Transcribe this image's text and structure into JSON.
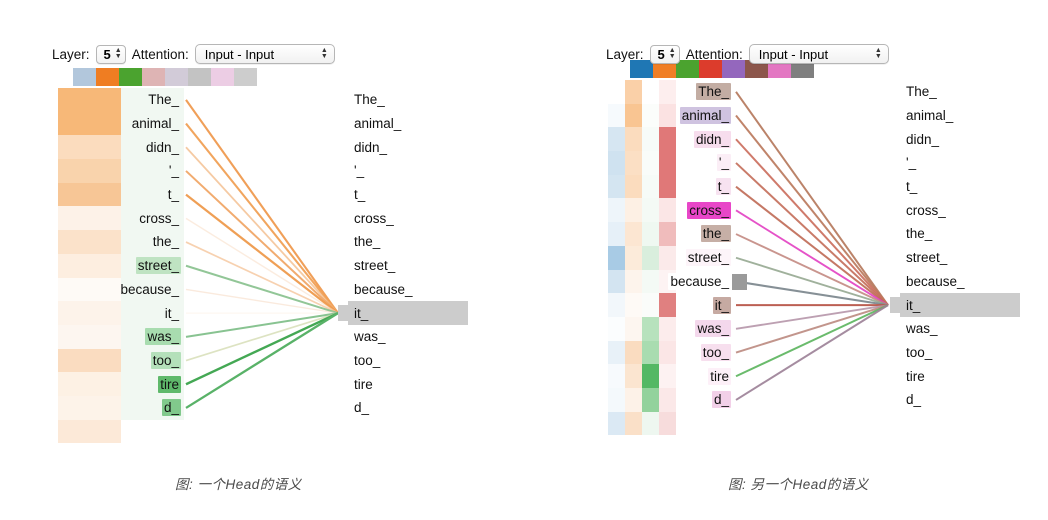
{
  "page": {
    "background": "#ffffff",
    "highlight_gray": "#cccccc",
    "selected_token": "it_"
  },
  "panels": [
    {
      "id": "left",
      "caption": "图: 一个Head的语义",
      "controls": {
        "layer_label": "Layer:",
        "layer_value": "5",
        "attention_label": "Attention:",
        "attention_value": "Input - Input",
        "up_arrow_icon": "▲",
        "down_arrow_icon": "▼"
      },
      "head_swatches": [
        {
          "name": "head-0",
          "color": "#b2c7dc"
        },
        {
          "name": "head-1",
          "color": "#ef7d22"
        },
        {
          "name": "head-2",
          "color": "#4ba32f"
        },
        {
          "name": "head-3",
          "color": "#deb4b4"
        },
        {
          "name": "head-4",
          "color": "#d2cbd8"
        },
        {
          "name": "head-5",
          "color": "#c3c3c3"
        },
        {
          "name": "head-6",
          "color": "#eccde4"
        },
        {
          "name": "head-7",
          "color": "#cdcdcd"
        }
      ],
      "tokens": [
        "The_",
        "animal_",
        "didn_",
        "'_",
        "t_",
        "cross_",
        "the_",
        "street_",
        "because_",
        "it_",
        "was_",
        "too_",
        "tire",
        "d_"
      ],
      "selected_index": 9,
      "heat_columns": [
        {
          "name": "orange-attention-column",
          "values": [
            "#f7b878",
            "#f7b878",
            "#fbdcbe",
            "#f9d3ac",
            "#f7c696",
            "#fdf2e8",
            "#fbe2ca",
            "#fdeee0",
            "#fefaf6",
            "#fdf3ea",
            "#fdf6f0",
            "#fadcc0",
            "#fdf1e4",
            "#fdf3e9",
            "#fce9d8"
          ]
        }
      ],
      "token_highlights": [
        {
          "index": 7,
          "color": "#bfe3c2"
        },
        {
          "index": 10,
          "color": "#a8dcaf"
        },
        {
          "index": 11,
          "color": "#b4e0ba"
        },
        {
          "index": 12,
          "color": "#5fb96b"
        },
        {
          "index": 13,
          "color": "#81c98c"
        }
      ],
      "token_column_bg": "#f1f8f2",
      "edges": [
        {
          "from": 0,
          "color": "#ef9a4f",
          "width": 2.1,
          "opacity": 0.95
        },
        {
          "from": 1,
          "color": "#f0a055",
          "width": 2.1,
          "opacity": 0.95
        },
        {
          "from": 2,
          "color": "#f2b884",
          "width": 1.8,
          "opacity": 0.75
        },
        {
          "from": 3,
          "color": "#efa25f",
          "width": 2.0,
          "opacity": 0.9
        },
        {
          "from": 4,
          "color": "#ee9a4c",
          "width": 2.2,
          "opacity": 0.95
        },
        {
          "from": 5,
          "color": "#f8ddc4",
          "width": 1.4,
          "opacity": 0.55
        },
        {
          "from": 6,
          "color": "#f3bd8e",
          "width": 1.7,
          "opacity": 0.7
        },
        {
          "from": 7,
          "color": "#86c08c",
          "width": 2.0,
          "opacity": 0.9
        },
        {
          "from": 8,
          "color": "#f6d6bb",
          "width": 1.3,
          "opacity": 0.5
        },
        {
          "from": 9,
          "color": "#fbeadd",
          "width": 1.2,
          "opacity": 0.4
        },
        {
          "from": 10,
          "color": "#7bbd85",
          "width": 2.0,
          "opacity": 0.9
        },
        {
          "from": 11,
          "color": "#cfd7a8",
          "width": 1.7,
          "opacity": 0.7
        },
        {
          "from": 12,
          "color": "#44a854",
          "width": 2.4,
          "opacity": 1.0
        },
        {
          "from": 13,
          "color": "#59b268",
          "width": 2.3,
          "opacity": 1.0
        }
      ]
    },
    {
      "id": "right",
      "caption": "图: 另一个Head的语义",
      "controls": {
        "layer_label": "Layer:",
        "layer_value": "5",
        "attention_label": "Attention:",
        "attention_value": "Input - Input",
        "up_arrow_icon": "▲",
        "down_arrow_icon": "▼"
      },
      "head_swatches": [
        {
          "name": "head-0",
          "color": "#1f77b4"
        },
        {
          "name": "head-1",
          "color": "#f07e25"
        },
        {
          "name": "head-2",
          "color": "#4ba32f"
        },
        {
          "name": "head-3",
          "color": "#dc3c2c"
        },
        {
          "name": "head-4",
          "color": "#9467bd"
        },
        {
          "name": "head-5",
          "color": "#8c564b"
        },
        {
          "name": "head-6",
          "color": "#e377c2"
        },
        {
          "name": "head-7",
          "color": "#7f7f7f"
        }
      ],
      "tokens": [
        "The_",
        "animal_",
        "didn_",
        "'_",
        "t_",
        "cross_",
        "the_",
        "street_",
        "because_",
        "it_",
        "was_",
        "too_",
        "tire",
        "d_"
      ],
      "selected_index": 9,
      "heat_columns": [
        {
          "name": "blue-attention-column",
          "values": [
            "#ffffff",
            "#f6fafd",
            "#d6e6f2",
            "#cfe2f0",
            "#d4e5f1",
            "#eef5fa",
            "#e6f0f8",
            "#a8cbe5",
            "#d3e4f1",
            "#f2f7fb",
            "#fbfdfe",
            "#e8f1f8",
            "#f7fafd",
            "#f4f9fc",
            "#dbe9f4"
          ]
        },
        {
          "name": "orange-attention-column",
          "values": [
            "#fad0a8",
            "#f9c592",
            "#fbdcbe",
            "#fbdfc4",
            "#fbdcbe",
            "#fdf0e4",
            "#fce6d2",
            "#fcebda",
            "#fdf4ec",
            "#fefaf6",
            "#fdf6f0",
            "#fadcc0",
            "#fbe5d0",
            "#fdf2e8",
            "#fae0c8"
          ]
        },
        {
          "name": "green-attention-column",
          "values": [
            "#ffffff",
            "#fbfdfb",
            "#f7fbf8",
            "#f9fcf9",
            "#f6fbf7",
            "#f4faf5",
            "#eff8f1",
            "#d9eedd",
            "#f4faf5",
            "#fafcfa",
            "#b7e2bd",
            "#a9dcb0",
            "#54b864",
            "#93d29c",
            "#eef7f0"
          ]
        },
        {
          "name": "red-attention-column",
          "values": [
            "#fdeeee",
            "#fbe2e2",
            "#e07878",
            "#e07878",
            "#e07878",
            "#fbe6e6",
            "#f0bcbc",
            "#fbeaea",
            "#fdf3f3",
            "#e08080",
            "#fcecec",
            "#fbe6e6",
            "#fdf2f2",
            "#fbe8e8",
            "#f7dcdc"
          ]
        }
      ],
      "token_highlights": [
        {
          "index": 0,
          "color": "#c3ada3"
        },
        {
          "index": 1,
          "color": "#cfc3e0"
        },
        {
          "index": 2,
          "color": "#f7dded"
        },
        {
          "index": 3,
          "color": "#fbeef6"
        },
        {
          "index": 4,
          "color": "#f7e2f0"
        },
        {
          "index": 5,
          "color": "#e846c8"
        },
        {
          "index": 6,
          "color": "#c6afa6"
        },
        {
          "index": 7,
          "color": "#fdf4f9"
        },
        {
          "index": 8,
          "color": "#ffffff"
        },
        {
          "index": 9,
          "color": "#c6aaa2"
        },
        {
          "index": 10,
          "color": "#f4d8ec"
        },
        {
          "index": 11,
          "color": "#f7dfee"
        },
        {
          "index": 12,
          "color": "#fdf0f8"
        },
        {
          "index": 13,
          "color": "#f2d0e8"
        }
      ],
      "token_column_bg": "#ffffff",
      "gray_marker": {
        "name": "because-gray-marker",
        "index": 8,
        "color": "#9a9a9a"
      },
      "edges": [
        {
          "from": 0,
          "color": "#b5785c",
          "width": 2.0,
          "opacity": 0.92
        },
        {
          "from": 1,
          "color": "#bb7a5d",
          "width": 2.0,
          "opacity": 0.92
        },
        {
          "from": 2,
          "color": "#cb6f5e",
          "width": 2.0,
          "opacity": 0.92
        },
        {
          "from": 3,
          "color": "#c4705c",
          "width": 2.0,
          "opacity": 0.92
        },
        {
          "from": 4,
          "color": "#c06d58",
          "width": 2.0,
          "opacity": 0.92
        },
        {
          "from": 5,
          "color": "#e23fc2",
          "width": 1.9,
          "opacity": 0.9
        },
        {
          "from": 6,
          "color": "#c0827a",
          "width": 1.9,
          "opacity": 0.85
        },
        {
          "from": 7,
          "color": "#8fa38b",
          "width": 1.9,
          "opacity": 0.85
        },
        {
          "from": 8,
          "color": "#7f8a90",
          "width": 2.1,
          "opacity": 0.95
        },
        {
          "from": 9,
          "color": "#b8564a",
          "width": 2.0,
          "opacity": 0.95
        },
        {
          "from": 10,
          "color": "#b28fa5",
          "width": 1.9,
          "opacity": 0.85
        },
        {
          "from": 11,
          "color": "#bb8a80",
          "width": 2.0,
          "opacity": 0.9
        },
        {
          "from": 12,
          "color": "#5db560",
          "width": 2.0,
          "opacity": 0.92
        },
        {
          "from": 13,
          "color": "#9b7f96",
          "width": 2.0,
          "opacity": 0.9
        }
      ]
    }
  ]
}
